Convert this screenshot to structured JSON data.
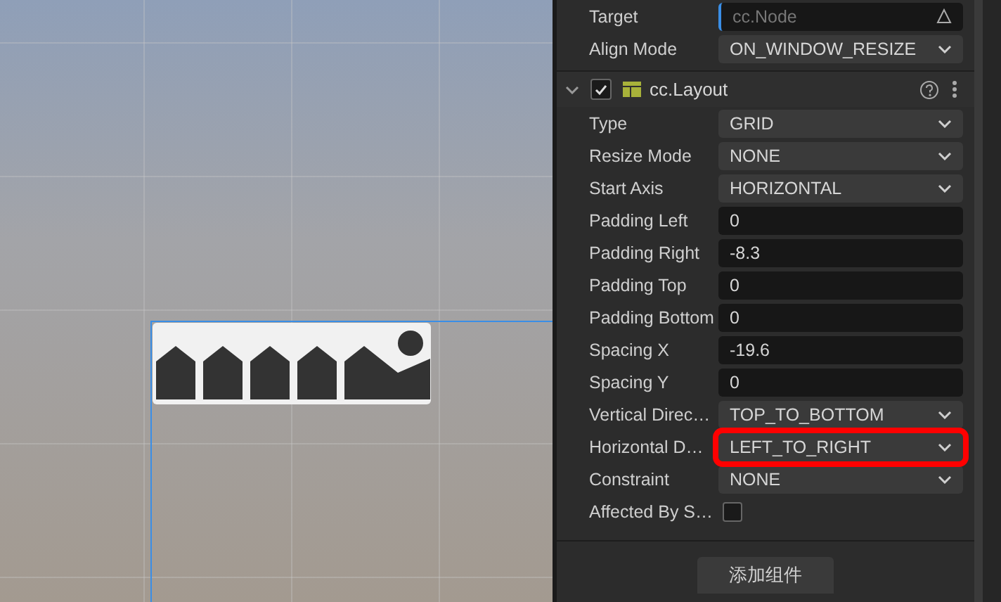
{
  "top_rows": [
    {
      "kind": "object",
      "label": "Target",
      "placeholder": "cc.Node"
    },
    {
      "kind": "select",
      "label": "Align Mode",
      "value": "ON_WINDOW_RESIZE"
    }
  ],
  "component": {
    "title": "cc.Layout",
    "expanded": true,
    "enabled": true
  },
  "properties": [
    {
      "kind": "select",
      "label": "Type",
      "value": "GRID",
      "highlighted": false
    },
    {
      "kind": "select",
      "label": "Resize Mode",
      "value": "NONE",
      "highlighted": false
    },
    {
      "kind": "select",
      "label": "Start Axis",
      "value": "HORIZONTAL",
      "highlighted": false
    },
    {
      "kind": "number",
      "label": "Padding Left",
      "value": "0",
      "highlighted": false
    },
    {
      "kind": "number",
      "label": "Padding Right",
      "value": "-8.3",
      "highlighted": false
    },
    {
      "kind": "number",
      "label": "Padding Top",
      "value": "0",
      "highlighted": false
    },
    {
      "kind": "number",
      "label": "Padding Bottom",
      "value": "0",
      "highlighted": false
    },
    {
      "kind": "number",
      "label": "Spacing X",
      "value": "-19.6",
      "highlighted": false
    },
    {
      "kind": "number",
      "label": "Spacing Y",
      "value": "0",
      "highlighted": false
    },
    {
      "kind": "select",
      "label": "Vertical Direc…",
      "value": "TOP_TO_BOTTOM",
      "highlighted": false
    },
    {
      "kind": "select",
      "label": "Horizontal D…",
      "value": "LEFT_TO_RIGHT",
      "highlighted": true
    },
    {
      "kind": "select",
      "label": "Constraint",
      "value": "NONE",
      "highlighted": false
    },
    {
      "kind": "checkbox",
      "label": "Affected By S…",
      "checked": false,
      "highlighted": false
    }
  ],
  "add_component_button": "添加组件"
}
